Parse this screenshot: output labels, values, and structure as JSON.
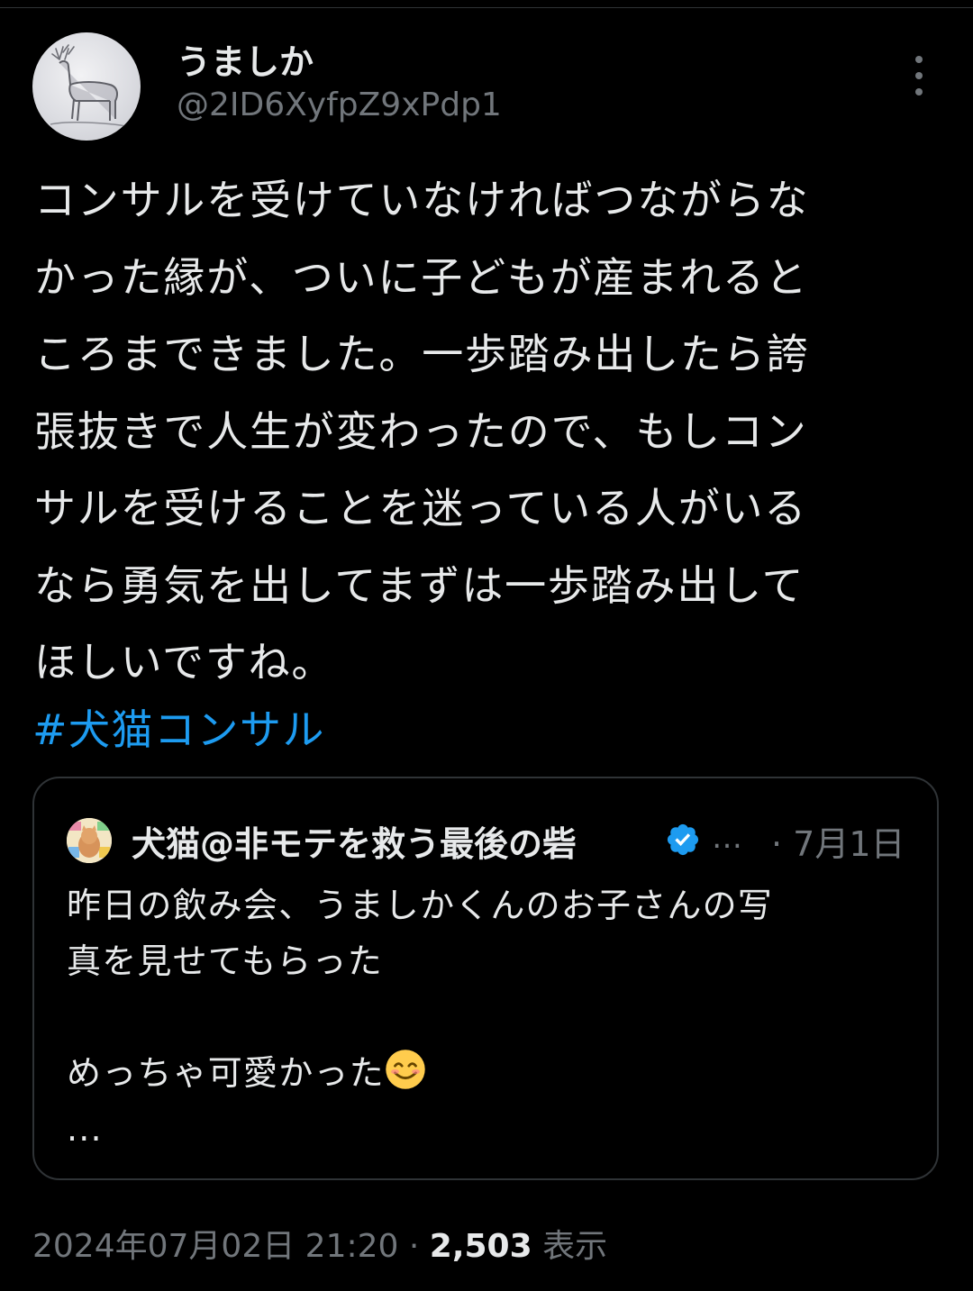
{
  "author": {
    "display_name": "うましか",
    "handle": "@2ID6XyfpZ9xPdp1"
  },
  "tweet": {
    "lines": [
      "コンサルを受けていなければつながらな",
      "かった縁が、ついに子どもが産まれると",
      "ころまできました。一歩踏み出したら誇",
      "張抜きで人生が変わったので、もしコン",
      "サルを受けることを迷っている人がいる",
      "なら勇気を出してまずは一歩踏み出して",
      "ほしいですね。"
    ],
    "hashtag": "#犬猫コンサル"
  },
  "quote": {
    "display_name": "犬猫@非モテを救う最後の砦",
    "ellipsis": "…",
    "date": "· 7月1日",
    "line_1": "昨日の飲み会、うましかくんのお子さんの写",
    "line_2": "真を見せてもらった",
    "line_3": "めっちゃ可愛かった",
    "line_4": "...",
    "verified_color": "#1d9bf0"
  },
  "meta": {
    "timestamp": "2024年07月02日 21:20",
    "separator": " · ",
    "views_count": "2,503",
    "views_label": " 表示"
  },
  "colors": {
    "background": "#000000",
    "text": "#e7e9ea",
    "secondary": "#71767b",
    "accent": "#1d9bf0",
    "border": "#2f3336"
  },
  "icons": {
    "more": "more-vertical-icon",
    "verified": "verified-badge-icon",
    "emoji": "smiling-face-emoji"
  }
}
